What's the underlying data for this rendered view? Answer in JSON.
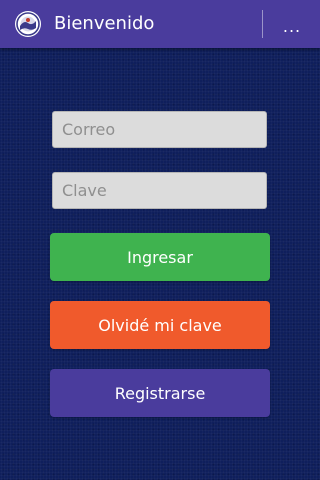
{
  "actionbar": {
    "title": "Bienvenido",
    "overflow_label": "...",
    "logo_icon": "app-logo-icon",
    "background": "#4a3c9d"
  },
  "form": {
    "email": {
      "placeholder": "Correo",
      "value": ""
    },
    "password": {
      "placeholder": "Clave",
      "value": ""
    }
  },
  "buttons": {
    "login": {
      "label": "Ingresar",
      "color": "#3fb34f"
    },
    "forgot": {
      "label": "Olvidé mi clave",
      "color": "#f05a2c"
    },
    "register": {
      "label": "Registrarse",
      "color": "#4a3c9d"
    }
  },
  "theme": {
    "background": "#0f1f5c",
    "text_on_color": "#ffffff"
  }
}
